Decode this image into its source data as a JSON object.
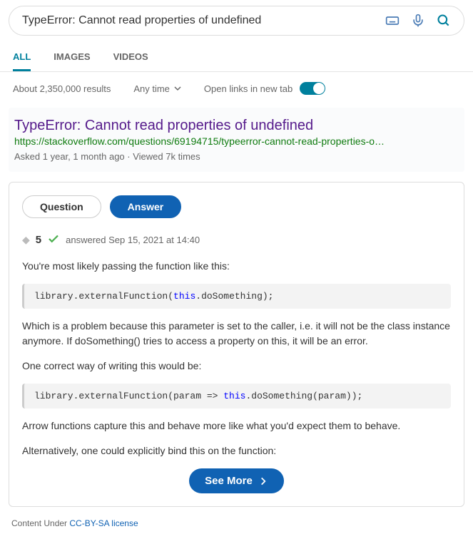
{
  "search": {
    "query": "TypeError: Cannot read properties of undefined"
  },
  "tabs": {
    "all": "ALL",
    "images": "IMAGES",
    "videos": "VIDEOS"
  },
  "meta": {
    "results": "About 2,350,000 results",
    "anytime": "Any time",
    "open_new_tab": "Open links in new tab"
  },
  "result": {
    "title": "TypeError: Cannot read properties of undefined",
    "url": "https://stackoverflow.com/questions/69194715/typeerror-cannot-read-properties-o…",
    "meta": "Asked 1 year, 1 month ago · Viewed 7k times"
  },
  "pills": {
    "question": "Question",
    "answer": "Answer"
  },
  "vote": {
    "score": "5",
    "answered": "answered Sep 15, 2021 at 14:40"
  },
  "body": {
    "p1": "You're most likely passing the function like this:",
    "code1_pre": "library.externalFunction(",
    "code1_kw": "this",
    "code1_post": ".doSomething);",
    "p2": "Which is a problem because this parameter is set to the caller, i.e. it will not be the class instance anymore. If doSomething() tries to access a property on this, it will be an error.",
    "p3": "One correct way of writing this would be:",
    "code2_pre": "library.externalFunction(param => ",
    "code2_kw": "this",
    "code2_post": ".doSomething(param));",
    "p4": "Arrow functions capture this and behave more like what you'd expect them to behave.",
    "p5": "Alternatively, one could explicitly bind this on the function:"
  },
  "see_more": "See More",
  "license": {
    "prefix": "Content Under ",
    "link": "CC-BY-SA license"
  }
}
